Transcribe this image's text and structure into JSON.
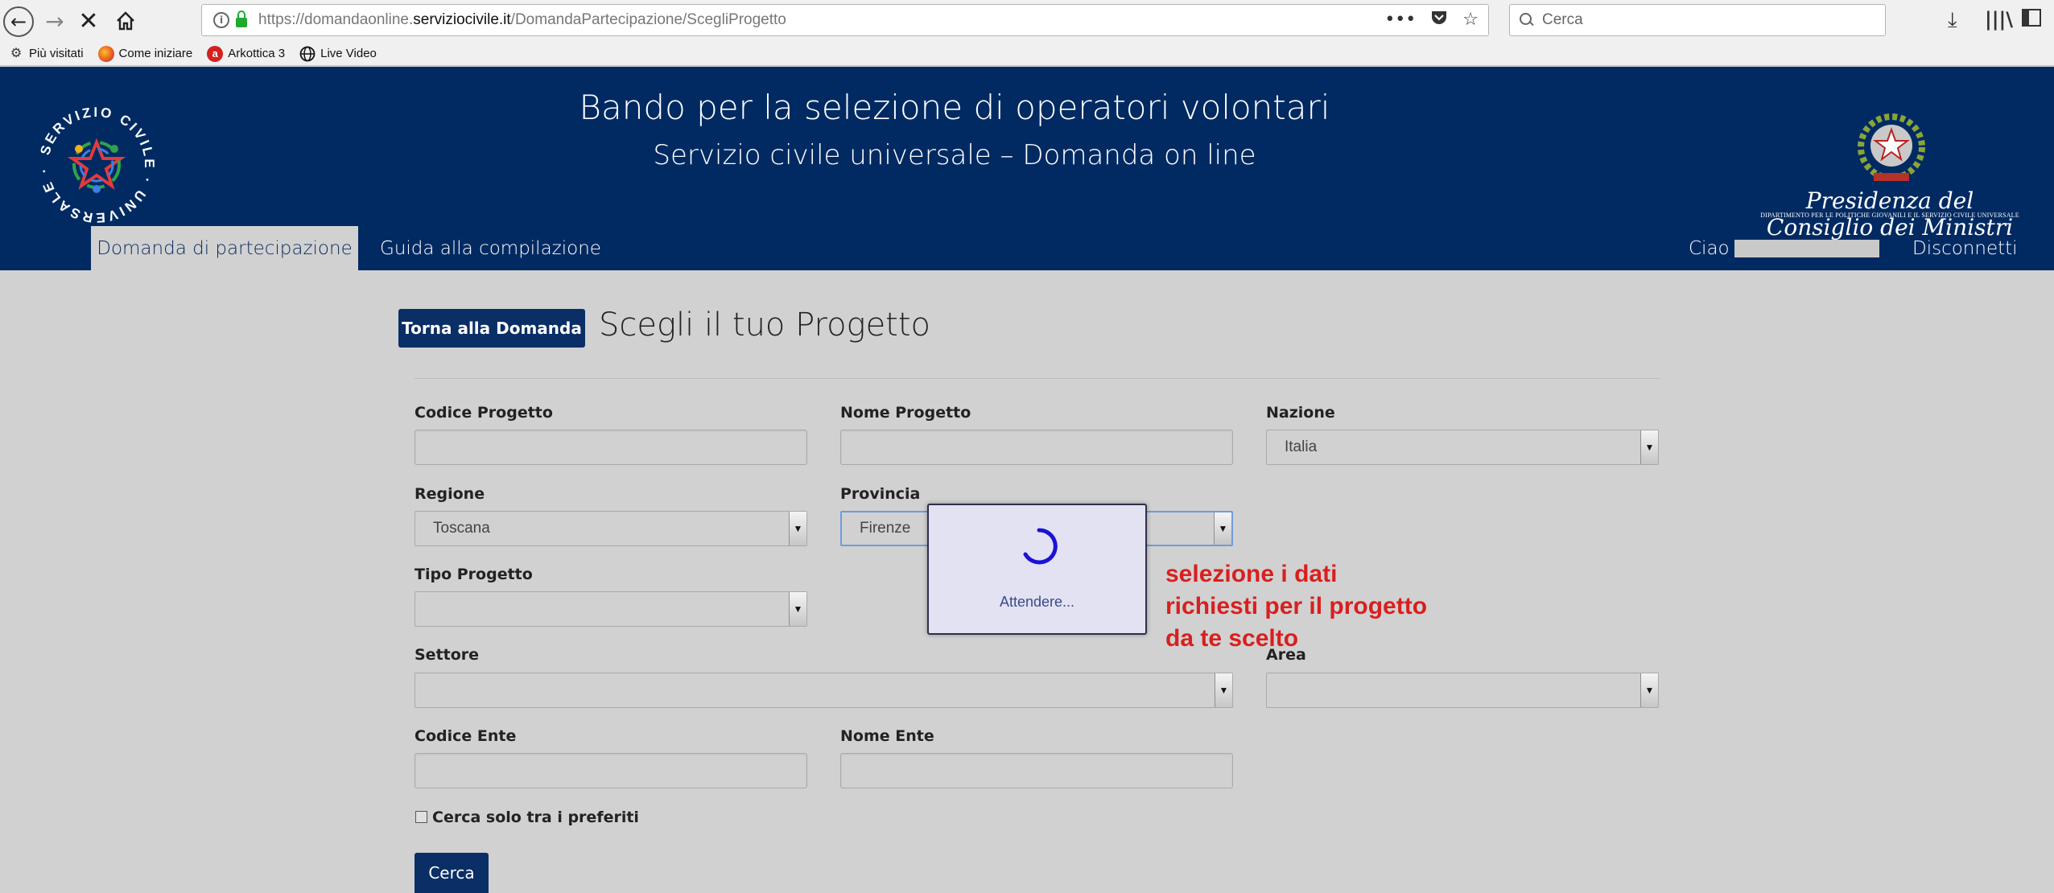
{
  "browser": {
    "url_prefix": "https://domandaonline.",
    "url_domain": "serviziocivile.it",
    "url_path": "/DomandaPartecipazione/ScegliProgetto",
    "search_placeholder": "Cerca",
    "bookmarks": [
      {
        "label": "Più visitati",
        "icon": "gear-icon"
      },
      {
        "label": "Come iniziare",
        "icon": "firefox-icon"
      },
      {
        "label": "Arkottica 3",
        "icon": "arkottica-icon"
      },
      {
        "label": "Live Video",
        "icon": "globe-icon"
      }
    ]
  },
  "header": {
    "title": "Bando per la selezione di operatori volontari",
    "subtitle": "Servizio civile universale – Domanda on line",
    "logo_text": "SERVIZIO CIVILE UNIVERSALE",
    "presidency": "Presidenza del Consiglio dei Ministri",
    "presidency_sub": "DIPARTIMENTO PER LE POLITICHE GIOVANILI E IL SERVIZIO CIVILE UNIVERSALE",
    "tabs": [
      {
        "label": "Domanda di partecipazione",
        "active": true
      },
      {
        "label": "Guida alla compilazione",
        "active": false
      }
    ],
    "greeting": "Ciao",
    "logout": "Disconnetti"
  },
  "main": {
    "back_button": "Torna alla Domanda",
    "title": "Scegli il tuo Progetto",
    "fields": {
      "codice_progetto": {
        "label": "Codice Progetto",
        "value": ""
      },
      "nome_progetto": {
        "label": "Nome Progetto",
        "value": ""
      },
      "nazione": {
        "label": "Nazione",
        "value": "Italia"
      },
      "regione": {
        "label": "Regione",
        "value": "Toscana"
      },
      "provincia": {
        "label": "Provincia",
        "value": "Firenze"
      },
      "tipo_progetto": {
        "label": "Tipo Progetto",
        "value": ""
      },
      "settore": {
        "label": "Settore",
        "value": ""
      },
      "area": {
        "label": "Area",
        "value": ""
      },
      "codice_ente": {
        "label": "Codice Ente",
        "value": ""
      },
      "nome_ente": {
        "label": "Nome Ente",
        "value": ""
      }
    },
    "favorites_checkbox": "Cerca solo tra i preferiti",
    "search_button": "Cerca"
  },
  "modal": {
    "text": "Attendere..."
  },
  "annotation": {
    "lines": [
      "selezione i dati",
      "richiesti per il progetto",
      "da te scelto"
    ],
    "color": "#d91f1f"
  },
  "colors": {
    "header_bg": "#022a62",
    "button_bg": "#0a2e66",
    "page_bg": "#d1d1d1"
  }
}
